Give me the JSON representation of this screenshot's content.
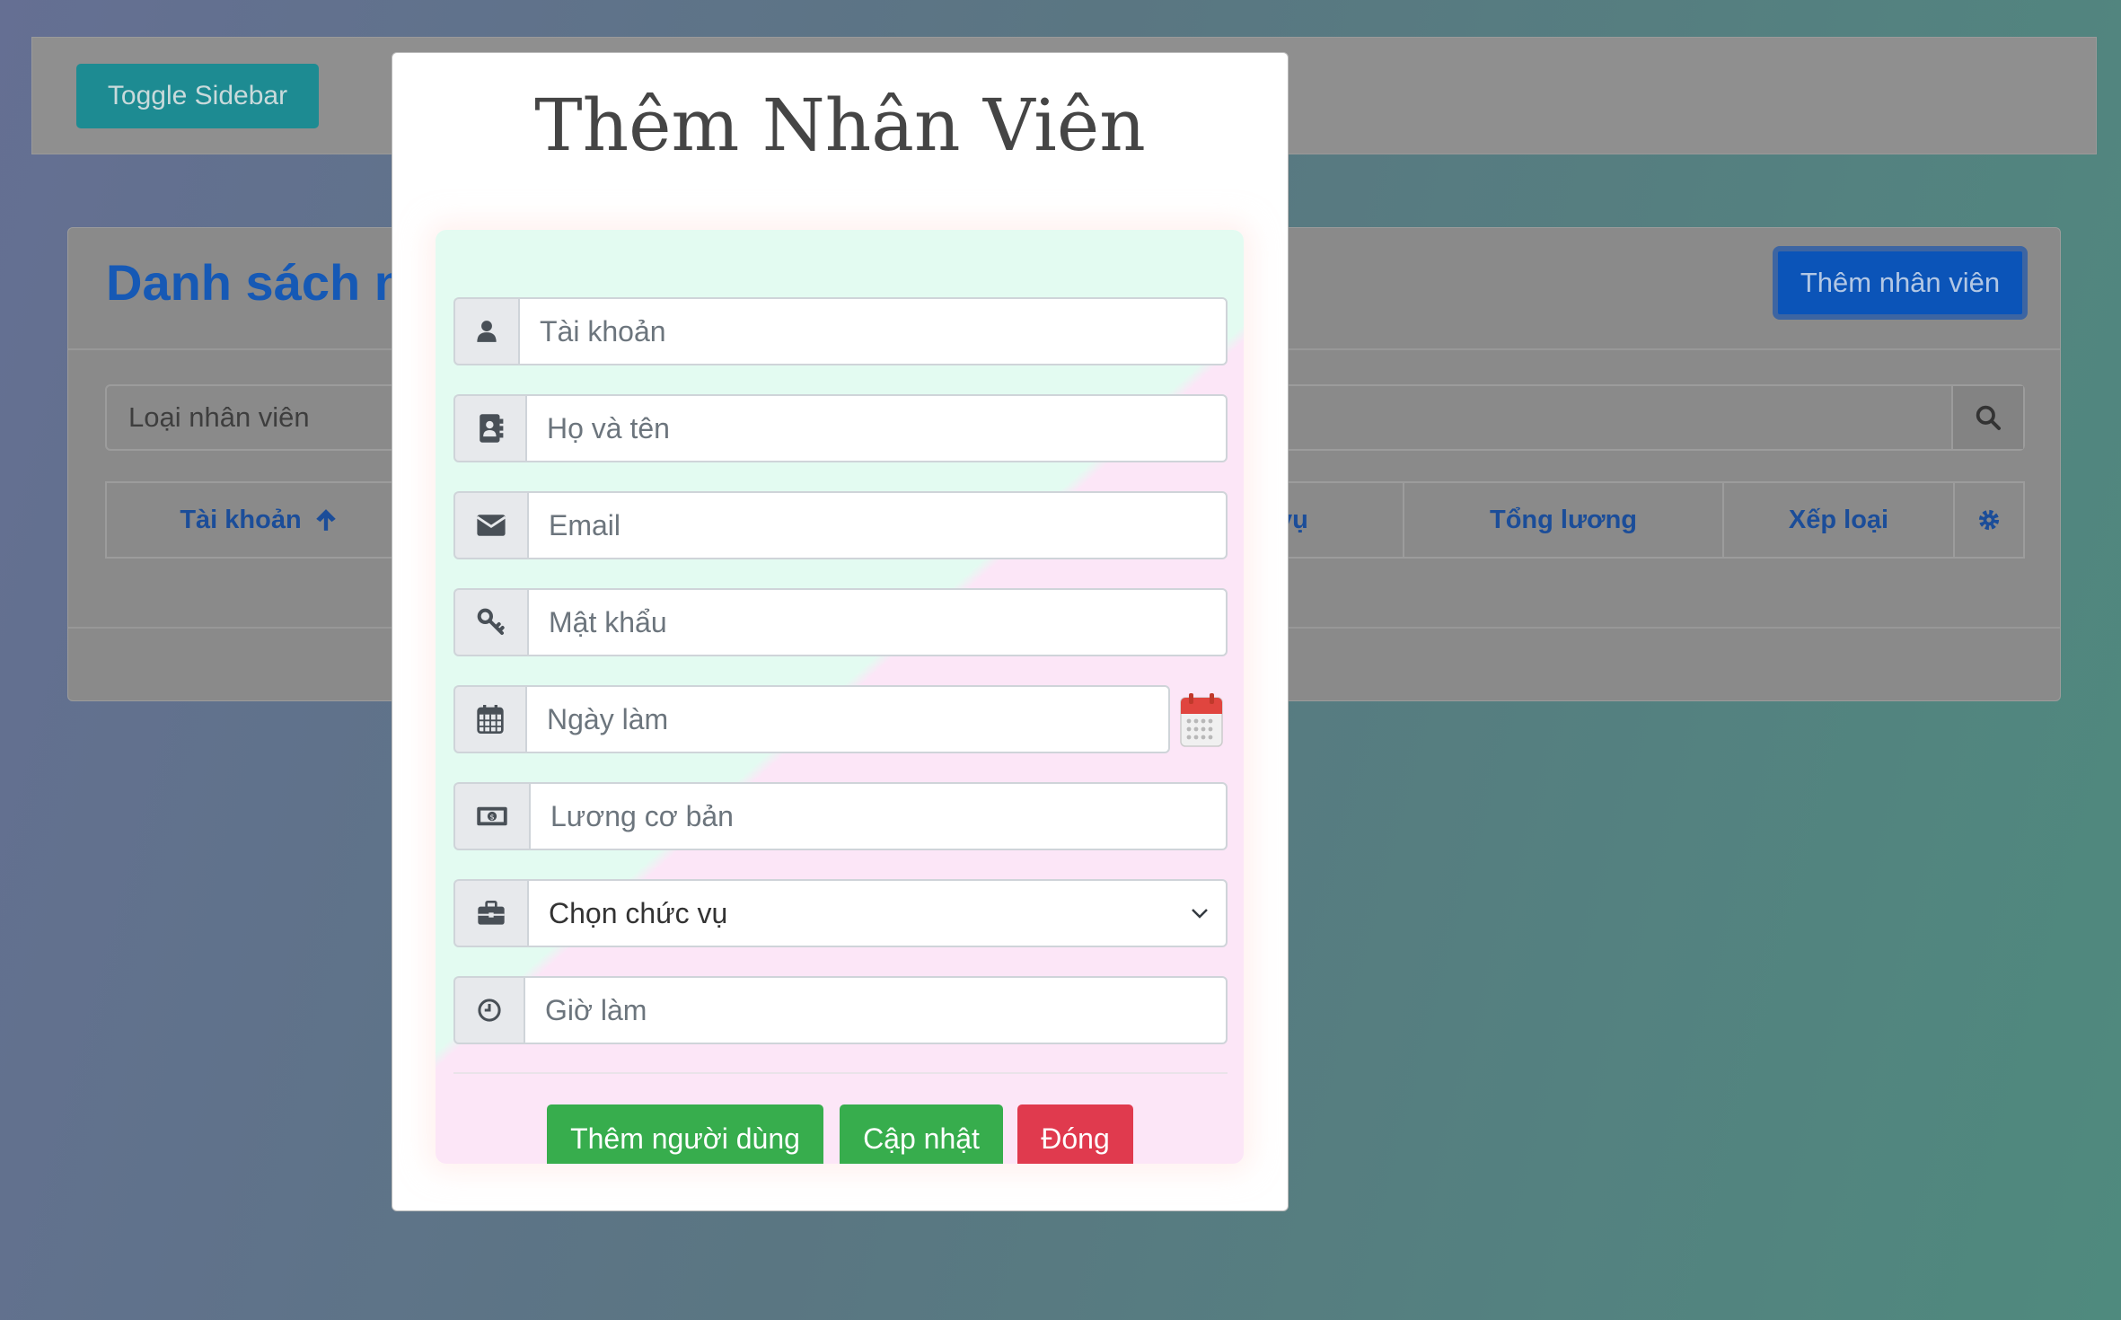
{
  "topbar": {
    "toggle_label": "Toggle Sidebar"
  },
  "card": {
    "title": "Danh sách nhân viên",
    "add_button": "Thêm nhân viên",
    "filter_placeholder": "Loại nhân viên",
    "columns": [
      "Tài khoản",
      "vụ",
      "Tổng lương",
      "Xếp loại"
    ]
  },
  "modal": {
    "title": "Thêm Nhân Viên",
    "fields": {
      "account": "Tài khoản",
      "fullname": "Họ và tên",
      "email": "Email",
      "password": "Mật khẩu",
      "workday": "Ngày làm",
      "salary": "Lương cơ bản",
      "position": "Chọn chức vụ",
      "hours": "Giờ làm"
    },
    "buttons": {
      "add_user": "Thêm người dùng",
      "update": "Cập nhật",
      "close": "Đóng"
    }
  },
  "colors": {
    "success": "#37ad4d",
    "danger": "#e03a4e",
    "primary": "#0b54b8",
    "teal": "#1d8b92"
  }
}
